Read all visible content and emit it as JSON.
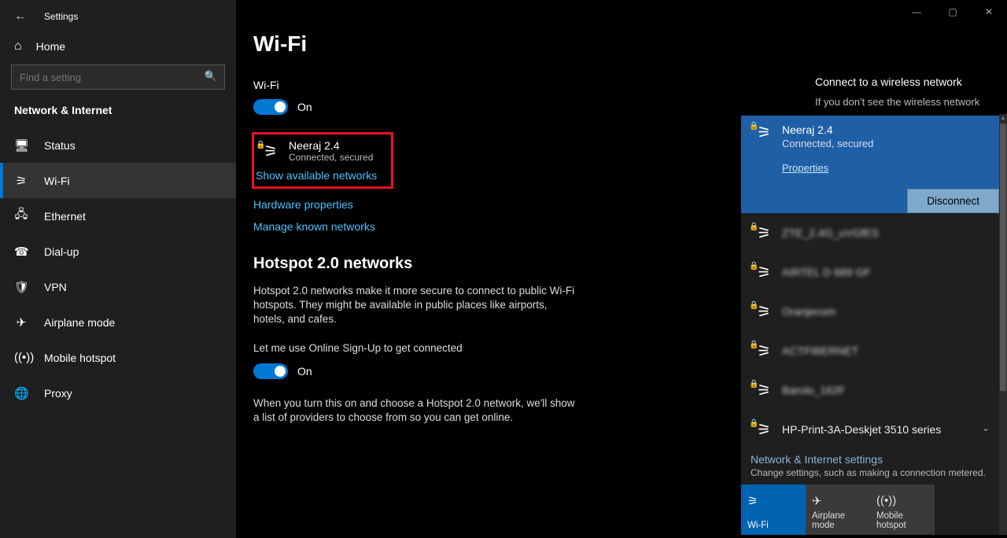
{
  "app": {
    "title": "Settings"
  },
  "sidebar": {
    "home": "Home",
    "search_placeholder": "Find a setting",
    "category": "Network & Internet",
    "items": [
      {
        "label": "Status"
      },
      {
        "label": "Wi-Fi"
      },
      {
        "label": "Ethernet"
      },
      {
        "label": "Dial-up"
      },
      {
        "label": "VPN"
      },
      {
        "label": "Airplane mode"
      },
      {
        "label": "Mobile hotspot"
      },
      {
        "label": "Proxy"
      }
    ]
  },
  "page": {
    "title": "Wi-Fi",
    "wifi_label": "Wi-Fi",
    "wifi_toggle_state": "On",
    "connected": {
      "name": "Neeraj 2.4",
      "status": "Connected, secured"
    },
    "show_networks": "Show available networks",
    "hardware_props": "Hardware properties",
    "manage_known": "Manage known networks",
    "hotspot_heading": "Hotspot 2.0 networks",
    "hotspot_body": "Hotspot 2.0 networks make it more secure to connect to public Wi-Fi hotspots. They might be available in public places like airports, hotels, and cafes.",
    "signup_label": "Let me use Online Sign-Up to get connected",
    "signup_state": "On",
    "signup_body": "When you turn this on and choose a Hotspot 2.0 network, we'll show a list of providers to choose from so you can get online."
  },
  "help": {
    "heading": "Connect to a wireless network",
    "sub": "If you don't see the wireless network"
  },
  "flyout": {
    "connected": {
      "name": "Neeraj 2.4",
      "status": "Connected, secured",
      "properties": "Properties",
      "disconnect": "Disconnect"
    },
    "networks": [
      {
        "name": "ZTE_2.4G_uVGfES",
        "secured": true,
        "blurred": true
      },
      {
        "name": "AIRTEL D 689 GF",
        "secured": true,
        "blurred": true
      },
      {
        "name": "Oranjecom",
        "secured": true,
        "blurred": true
      },
      {
        "name": "ACTFIBERNET",
        "secured": true,
        "blurred": true
      },
      {
        "name": "Barolo_162F",
        "secured": true,
        "blurred": true
      },
      {
        "name": "HP-Print-3A-Deskjet 3510 series",
        "secured": true,
        "blurred": false
      }
    ],
    "settings_title": "Network & Internet settings",
    "settings_sub": "Change settings, such as making a connection metered.",
    "tiles": [
      {
        "label": "Wi-Fi",
        "state": "on"
      },
      {
        "label": "Airplane mode",
        "state": "off"
      },
      {
        "label": "Mobile hotspot",
        "state": "off"
      }
    ]
  }
}
